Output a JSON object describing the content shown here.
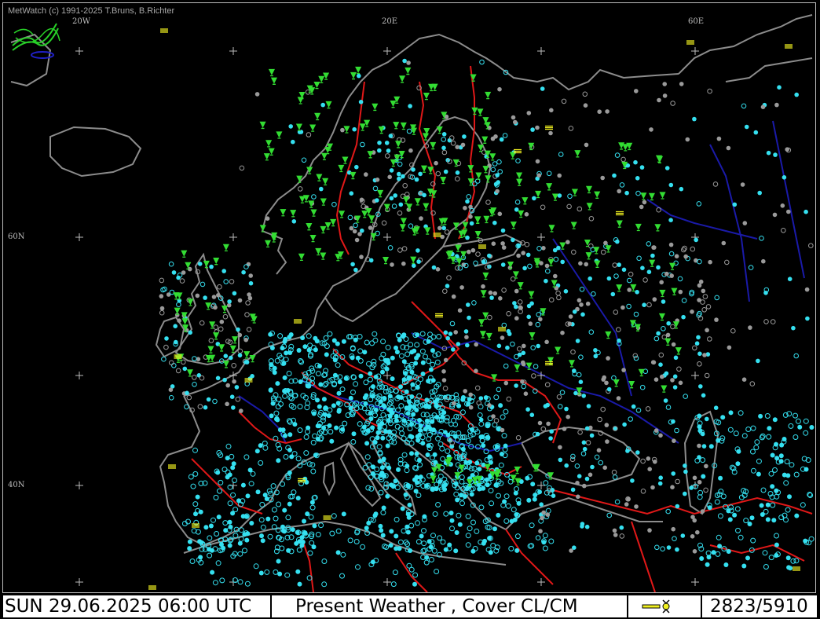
{
  "copyright": "MetWatch  (c) 1991-2025 T.Bruns, B.Richter",
  "graticule_labels": {
    "lon_20w": "20W",
    "lon_20e": "20E",
    "lon_60e": "60E",
    "lat_60n": "60N",
    "lat_40n": "40N"
  },
  "status_bar": {
    "datetime": "SUN 29.06.2025 06:00 UTC",
    "product": "Present Weather    , Cover CL/CM",
    "station_count": "2823/5910"
  },
  "colors": {
    "background": "#000000",
    "coastline": "#8c8c8c",
    "border": "#e01818",
    "river": "#1a1aa8",
    "station_clear": "#35e0f0",
    "station_cloudy": "#9a9a9a",
    "weather_rain": "#33dd33",
    "weather_fog": "#f0f020",
    "frame": "#bdbdbd"
  },
  "icons": {
    "logo": "metwatch-logo-icon",
    "legend": "weather-symbol-legend-icon"
  }
}
